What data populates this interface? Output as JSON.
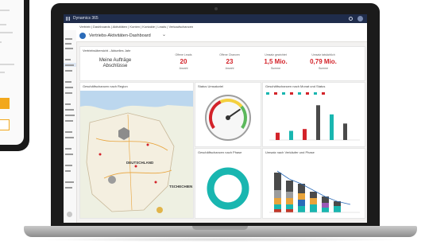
{
  "phone": {
    "accent_color": "#f2a81d"
  },
  "app": {
    "top_bar_title": "Dynamics 365",
    "nav_text": "Vertrieb  |  Dashboards  |  Aktivitäten  |  Konten  |  Kontakte  |  Leads  |  Verkaufschancen",
    "page_title": "Vertriebs-Aktivitäten-Dashboard",
    "sidebar_items": [
      "Startseite",
      "Zuletzt",
      "Angeheftet",
      "Meine Arbeit",
      "Dashboards",
      "Aktivitäten",
      "Kunden",
      "Konten",
      "Kontakte",
      "Vertrieb",
      "Leads",
      "Verkaufschancen",
      "Wettbewerber",
      "Zusammenarbeit",
      "Marketing",
      "Kampagnen",
      "Service",
      "Apps"
    ],
    "header_color": "#1f2c4b",
    "accent_color": "#2b6bb8"
  },
  "dashboard": {
    "header_text": "Vertriebsübersicht - Aktuelles Jahr",
    "kpi_intro_line1": "Meine Aufträge",
    "kpi_intro_line2": "Abschlüsse",
    "kpis": [
      {
        "title": "Offene Leads",
        "value": "20",
        "subtitle": "Anzahl"
      },
      {
        "title": "Offene Chancen",
        "value": "23",
        "subtitle": "Anzahl"
      },
      {
        "title": "Umsatz gewichtet",
        "value": "1,5 Mio.",
        "subtitle": "Summe"
      },
      {
        "title": "Umsatz tatsächlich",
        "value": "0,79 Mio.",
        "subtitle": "Summe"
      }
    ],
    "map_tile_title": "Geschäftschancen nach Region",
    "map_labels": [
      "DEUTSCHLAND",
      "TSCHECHIEN"
    ],
    "gauge_tile_title": "Status Umsatzziel",
    "gauge_value": 0.72,
    "bar_tile_title": "Geschäftschancen nach Monat und Status",
    "bar_values": [
      0.2,
      0.25,
      0.3,
      0.95,
      0.7,
      0.45
    ],
    "donut_tile_title": "Geschäftschancen nach Phase",
    "donut_color": "#19b6b0",
    "stack_tile_title": "Umsatz nach Verkäufer und Phase",
    "kpi_color": "#d3232a"
  }
}
